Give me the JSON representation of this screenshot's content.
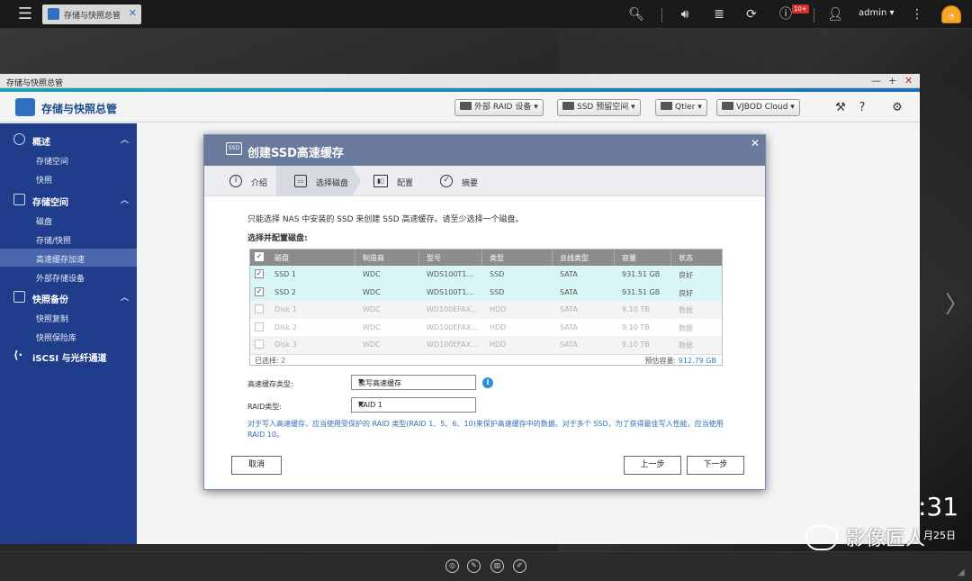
{
  "topbar": {
    "app_tab_label": "存储与快照总管",
    "user": "admin",
    "notification_badge": "10+",
    "user_menu_caret": "▾",
    "icons": [
      "menu-icon",
      "search-icon",
      "volume-icon",
      "stack-icon",
      "sync-icon",
      "info-icon",
      "user-icon",
      "more-icon",
      "dashboard-gauge-icon"
    ]
  },
  "window": {
    "title": "存储与快照总管",
    "app_name": "存储与快照总管",
    "controls": [
      "—",
      "+",
      "✕"
    ],
    "header_buttons": [
      {
        "label": "外部 RAID 设备",
        "caret": "▾"
      },
      {
        "label": "SSD 预留空间",
        "caret": "▾"
      },
      {
        "label": "Qtier",
        "caret": "▾"
      },
      {
        "label": "VJBOD Cloud",
        "caret": "▾"
      }
    ]
  },
  "sidebar": {
    "groups": [
      {
        "label": "概述",
        "items": [
          "存储空间",
          "快照"
        ]
      },
      {
        "label": "存储空间",
        "items": [
          "磁盘",
          "存储/快照",
          "高速缓存加速",
          "外部存储设备"
        ]
      },
      {
        "label": "快照备份",
        "items": [
          "快照复制",
          "快照保险库"
        ]
      },
      {
        "label": "iSCSI 与光纤通道",
        "items": []
      }
    ],
    "active_item": "高速缓存加速"
  },
  "dialog": {
    "title": "创建SSD高速缓存",
    "ssd_icon_text": "SSD",
    "steps": [
      "介绍",
      "选择磁盘",
      "配置",
      "摘要"
    ],
    "current_step": "选择磁盘",
    "intro": "只能选择 NAS 中安装的 SSD 来创建 SSD 高速缓存。请至少选择一个磁盘。",
    "section_title": "选择并配置磁盘:",
    "table": {
      "columns": [
        "磁盘",
        "制造商",
        "型号",
        "类型",
        "总线类型",
        "容量",
        "状态"
      ],
      "rows": [
        {
          "checked": true,
          "enabled": true,
          "cells": [
            "SSD 1",
            "WDC",
            "WDS100T1...",
            "SSD",
            "SATA",
            "931.51 GB",
            "良好"
          ]
        },
        {
          "checked": true,
          "enabled": true,
          "cells": [
            "SSD 2",
            "WDC",
            "WDS100T1...",
            "SSD",
            "SATA",
            "931.51 GB",
            "良好"
          ]
        },
        {
          "checked": false,
          "enabled": false,
          "cells": [
            "Disk 1",
            "WDC",
            "WD100EFAX...",
            "HDD",
            "SATA",
            "9.10 TB",
            "数据"
          ]
        },
        {
          "checked": false,
          "enabled": false,
          "cells": [
            "Disk 2",
            "WDC",
            "WD100EFAX...",
            "HDD",
            "SATA",
            "9.10 TB",
            "数据"
          ]
        },
        {
          "checked": false,
          "enabled": false,
          "cells": [
            "Disk 3",
            "WDC",
            "WD100EFAX...",
            "HDD",
            "SATA",
            "9.10 TB",
            "数据"
          ]
        }
      ],
      "selected_label": "已选择:",
      "selected_count": "2",
      "capacity_label": "预估容量:",
      "capacity_value": "912.79 GB"
    },
    "cache_type_label": "高速缓存类型:",
    "cache_type_value": "读写高速缓存",
    "raid_type_label": "RAID类型:",
    "raid_type_value": "RAID 1",
    "note": "对于写入高速缓存，应当使用受保护的 RAID 类型(RAID 1、5、6、10)来保护高速缓存中的数据。对于多个 SSD，为了获得最佳写入性能，应当使用 RAID 10。",
    "buttons": {
      "cancel": "取消",
      "back": "上一步",
      "next": "下一步"
    }
  },
  "desktop": {
    "clock": ":31",
    "date": "月25日",
    "watermark": "影像匠人"
  }
}
